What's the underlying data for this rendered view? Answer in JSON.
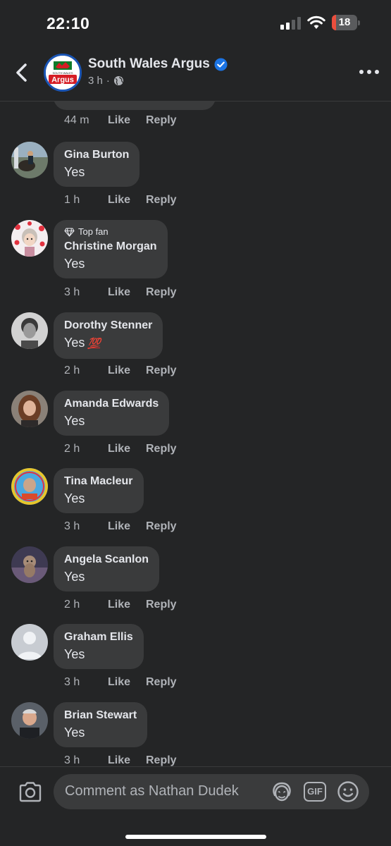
{
  "status_bar": {
    "time": "22:10",
    "battery": "18",
    "battery_level_percent": 18,
    "signal_bars_active": 2
  },
  "header": {
    "title": "South Wales Argus",
    "time": "3 h",
    "separator": "·",
    "logo_text_top": "SOUTH WALES",
    "logo_text_main": "Argus"
  },
  "partial_comment": {
    "time": "44 m",
    "like": "Like",
    "reply": "Reply"
  },
  "comments": [
    {
      "name": "Gina Burton",
      "text": "Yes",
      "time": "1 h",
      "like": "Like",
      "reply": "Reply"
    },
    {
      "badge": "Top fan",
      "name": "Christine Morgan",
      "text": "Yes",
      "time": "3 h",
      "like": "Like",
      "reply": "Reply"
    },
    {
      "name": "Dorothy Stenner",
      "text": "Yes",
      "emoji": "💯",
      "time": "2 h",
      "like": "Like",
      "reply": "Reply"
    },
    {
      "name": "Amanda Edwards",
      "text": "Yes",
      "time": "2 h",
      "like": "Like",
      "reply": "Reply"
    },
    {
      "name": "Tina Macleur",
      "text": "Yes",
      "time": "3 h",
      "like": "Like",
      "reply": "Reply"
    },
    {
      "name": "Angela Scanlon",
      "text": "Yes",
      "time": "2 h",
      "like": "Like",
      "reply": "Reply"
    },
    {
      "name": "Graham Ellis",
      "text": "Yes",
      "time": "3 h",
      "like": "Like",
      "reply": "Reply"
    },
    {
      "name": "Brian Stewart",
      "text": "Yes",
      "time": "3 h",
      "like": "Like",
      "reply": "Reply"
    }
  ],
  "composer": {
    "placeholder": "Comment as Nathan Dudek",
    "gif_label": "GIF"
  },
  "colors": {
    "background": "#242526",
    "bubble": "#3a3b3c",
    "verified": "#1b74e4",
    "battery_low": "#eb4e3d",
    "muted_text": "#b0b3b8"
  }
}
